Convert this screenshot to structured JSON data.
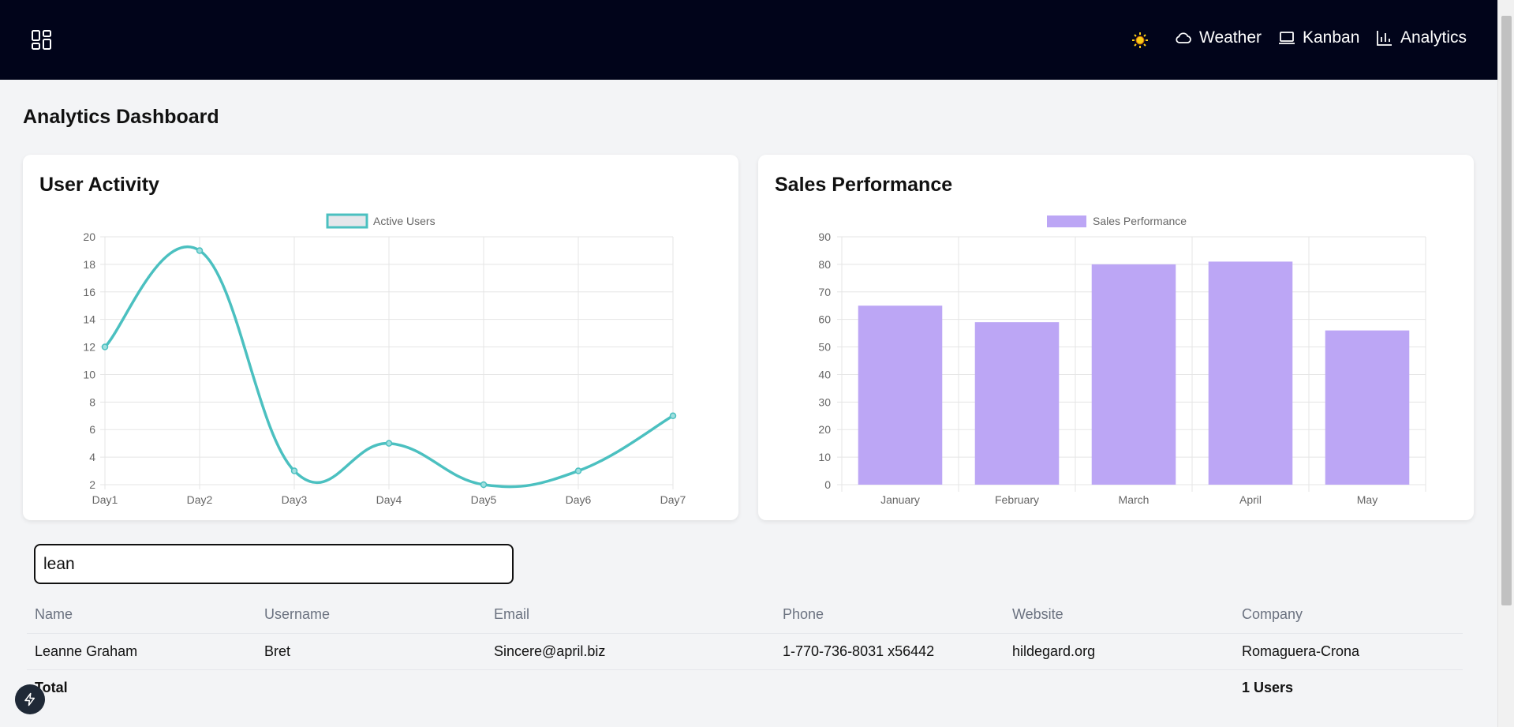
{
  "header": {
    "nav": [
      {
        "label": "Weather",
        "icon": "cloud-icon"
      },
      {
        "label": "Kanban",
        "icon": "laptop-icon"
      },
      {
        "label": "Analytics",
        "icon": "bar-chart-icon"
      }
    ],
    "theme_icon": "sun-icon",
    "logo_icon": "dashboard-icon",
    "colors": {
      "background": "#01041a",
      "sun": "#facc15"
    }
  },
  "page_title": "Analytics Dashboard",
  "chart_data": [
    {
      "type": "line",
      "title": "User Activity",
      "categories": [
        "Day1",
        "Day2",
        "Day3",
        "Day4",
        "Day5",
        "Day6",
        "Day7"
      ],
      "series": [
        {
          "name": "Active Users",
          "values": [
            12,
            19,
            3,
            5,
            2,
            3,
            7
          ],
          "color": "#4bc0c0"
        }
      ],
      "ylim": [
        2,
        20
      ],
      "yticks": [
        2,
        4,
        6,
        8,
        10,
        12,
        14,
        16,
        18,
        20
      ],
      "grid": true,
      "legend": "top"
    },
    {
      "type": "bar",
      "title": "Sales Performance",
      "categories": [
        "January",
        "February",
        "March",
        "April",
        "May"
      ],
      "series": [
        {
          "name": "Sales Performance",
          "values": [
            65,
            59,
            80,
            81,
            56
          ],
          "color": "#bca6f5"
        }
      ],
      "ylim": [
        0,
        90
      ],
      "yticks": [
        0,
        10,
        20,
        30,
        40,
        50,
        60,
        70,
        80,
        90
      ],
      "grid": true,
      "legend": "top"
    }
  ],
  "search": {
    "value": "lean"
  },
  "table": {
    "columns": [
      "Name",
      "Username",
      "Email",
      "Phone",
      "Website",
      "Company"
    ],
    "rows": [
      [
        "Leanne Graham",
        "Bret",
        "Sincere@april.biz",
        "1-770-736-8031 x56442",
        "hildegard.org",
        "Romaguera-Crona"
      ]
    ],
    "total_label": "Total",
    "total_value": "1 Users"
  },
  "fab_icon": "lightning-icon"
}
